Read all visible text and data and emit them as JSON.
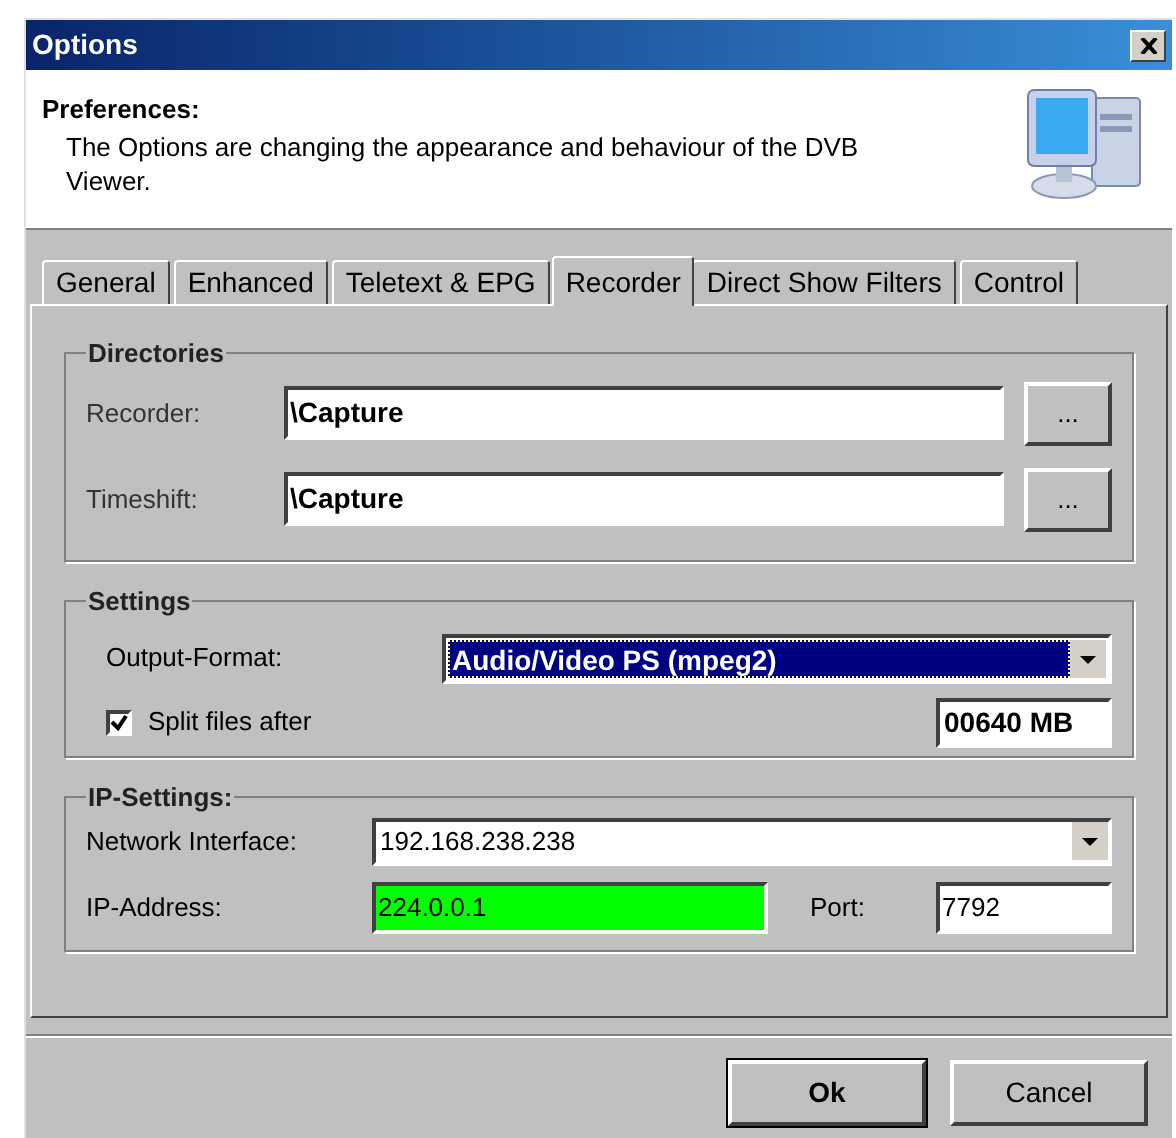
{
  "window": {
    "title": "Options"
  },
  "header": {
    "title": "Preferences:",
    "description": "The Options are changing the appearance and behaviour of the DVB Viewer."
  },
  "tabs": [
    {
      "label": "General",
      "selected": false
    },
    {
      "label": "Enhanced",
      "selected": false
    },
    {
      "label": "Teletext & EPG",
      "selected": false
    },
    {
      "label": "Recorder",
      "selected": true
    },
    {
      "label": "Direct Show Filters",
      "selected": false
    },
    {
      "label": "Control",
      "selected": false
    }
  ],
  "directories": {
    "title": "Directories",
    "rows": [
      {
        "label": "Recorder:",
        "value": "\\Capture",
        "button": "..."
      },
      {
        "label": "Timeshift:",
        "value": "\\Capture",
        "button": "..."
      }
    ]
  },
  "settings": {
    "title": "Settings",
    "output_format": {
      "label": "Output-Format:",
      "value": "Audio/Video PS (mpeg2)"
    },
    "split": {
      "label": "Split files after",
      "checked": true,
      "value": "00640 MB"
    }
  },
  "ip_settings": {
    "title": "IP-Settings:",
    "network_interface": {
      "label": "Network Interface:",
      "value": "192.168.238.238"
    },
    "ip_address": {
      "label": "IP-Address:",
      "value": "224.0.0.1",
      "valid": true
    },
    "port": {
      "label": "Port:",
      "value": "7792"
    }
  },
  "buttons": [
    {
      "label": "Ok",
      "default": true
    },
    {
      "label": "Cancel",
      "default": false
    }
  ]
}
